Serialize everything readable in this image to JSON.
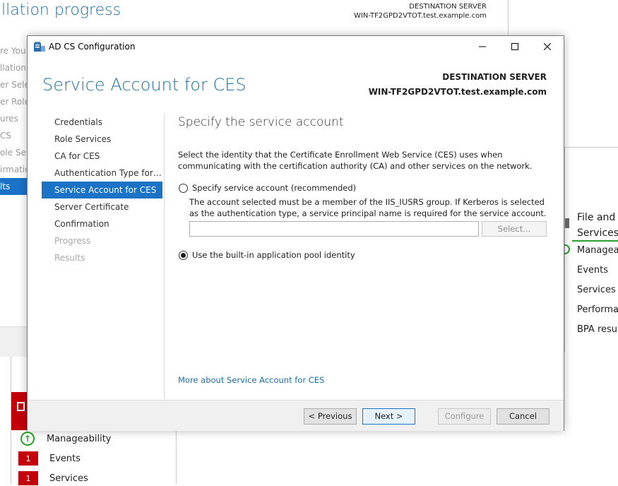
{
  "background": {
    "wizard_title": "llation progress",
    "destination_label": "DESTINATION SERVER",
    "destination_server": "WIN-TF2GPD2VTOT.test.example.com",
    "nav_items": [
      "re You",
      "llation T",
      "er Selec",
      "er Role",
      "ures",
      "CS",
      "ole Ser",
      "irmatio",
      "lts"
    ],
    "left_tile": {
      "rows": [
        {
          "label": "Manageability",
          "status": "ok"
        },
        {
          "label": "Events",
          "count": "1"
        },
        {
          "label": "Services",
          "count": "1"
        }
      ]
    },
    "right_tile": {
      "heading_line1": "File and",
      "heading_line2": "Services",
      "items": [
        "Managea",
        "Events",
        "Services",
        "Performan",
        "BPA resul"
      ]
    }
  },
  "dialog": {
    "window_title": "AD CS Configuration",
    "controls": {
      "minimize": "—",
      "maximize": "☐",
      "close": "✕"
    },
    "page_title": "Service Account for CES",
    "destination_label": "DESTINATION SERVER",
    "destination_server": "WIN-TF2GPD2VTOT.test.example.com",
    "nav": [
      {
        "label": "Credentials",
        "state": "normal"
      },
      {
        "label": "Role Services",
        "state": "normal"
      },
      {
        "label": "CA for CES",
        "state": "normal"
      },
      {
        "label": "Authentication Type for C...",
        "state": "normal"
      },
      {
        "label": "Service Account for CES",
        "state": "active"
      },
      {
        "label": "Server Certificate",
        "state": "normal"
      },
      {
        "label": "Confirmation",
        "state": "normal"
      },
      {
        "label": "Progress",
        "state": "disabled"
      },
      {
        "label": "Results",
        "state": "disabled"
      }
    ],
    "content": {
      "heading": "Specify the service account",
      "description": "Select the identity that the Certificate Enrollment Web Service (CES) uses when communicating with the certification authority (CA) and other services on the network.",
      "option_specify": "Specify service account (recommended)",
      "option_specify_note": "The account selected must be a member of the IIS_IUSRS group. If Kerberos is selected as the authentication type, a service principal name is required for the service account.",
      "account_value": "",
      "select_button": "Select...",
      "option_builtin": "Use the built-in application pool identity",
      "selected_option": "builtin",
      "more_link": "More about Service Account for CES"
    },
    "footer": {
      "previous": "< Previous",
      "next": "Next >",
      "configure": "Configure",
      "cancel": "Cancel"
    }
  }
}
